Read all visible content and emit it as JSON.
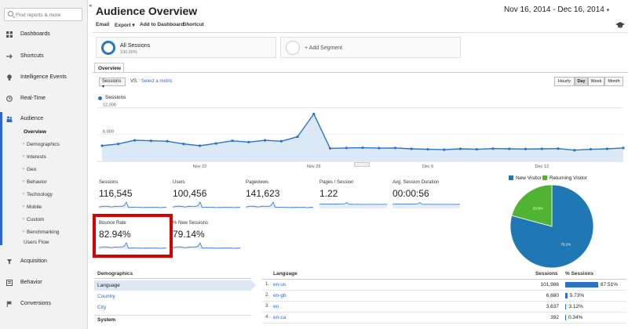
{
  "sidebar": {
    "search_placeholder": "Find reports & more",
    "items": [
      {
        "label": "Dashboards"
      },
      {
        "label": "Shortcuts"
      },
      {
        "label": "Intelligence Events"
      },
      {
        "label": "Real-Time"
      },
      {
        "label": "Audience"
      },
      {
        "label": "Acquisition"
      },
      {
        "label": "Behavior"
      },
      {
        "label": "Conversions"
      }
    ],
    "audience_sub": [
      {
        "label": "Overview"
      },
      {
        "label": "Demographics"
      },
      {
        "label": "Interests"
      },
      {
        "label": "Geo"
      },
      {
        "label": "Behavior"
      },
      {
        "label": "Technology"
      },
      {
        "label": "Mobile"
      },
      {
        "label": "Custom"
      },
      {
        "label": "Benchmarking"
      },
      {
        "label": "Users Flow"
      }
    ]
  },
  "header": {
    "title": "Audience Overview",
    "date_range": "Nov 16, 2014 - Dec 16, 2014"
  },
  "toolbar": {
    "email": "Email",
    "export": "Export",
    "add_dashboard": "Add to Dashboard",
    "shortcut": "Shortcut"
  },
  "segments": {
    "all_sessions": "All Sessions",
    "all_sessions_pct": "100.00%",
    "add_segment": "+ Add Segment"
  },
  "tabs": {
    "overview": "Overview"
  },
  "chart_controls": {
    "metric": "Sessions",
    "vs": "VS.",
    "select_metric": "Select a metric",
    "granularity": [
      "Hourly",
      "Day",
      "Week",
      "Month"
    ],
    "selected_granularity": "Day"
  },
  "chart_data": {
    "type": "area",
    "legend": "Sessions",
    "y_ticks": [
      6000,
      12000
    ],
    "y_tick_labels": [
      "6,000",
      "12,000"
    ],
    "ylim": [
      0,
      12600
    ],
    "x_tick_labels": [
      "Nov 22",
      "Nov 29",
      "Dec 6",
      "Dec 13"
    ],
    "x_tick_indices": [
      6,
      13,
      20,
      27
    ],
    "values": [
      3500,
      3900,
      4700,
      4600,
      4500,
      3900,
      3500,
      4000,
      4600,
      4300,
      4700,
      4500,
      5500,
      10600,
      2900,
      3000,
      3050,
      2950,
      3000,
      2800,
      2700,
      2600,
      2800,
      2700,
      2850,
      2800,
      2750,
      2800,
      2850,
      2500,
      2700,
      2800,
      3000
    ],
    "color": "#2a73c5",
    "fill": "#dbe9f6"
  },
  "metrics": [
    {
      "label": "Sessions",
      "value": "116,545"
    },
    {
      "label": "Users",
      "value": "100,456"
    },
    {
      "label": "Pageviews",
      "value": "141,623"
    },
    {
      "label": "Pages / Session",
      "value": "1.22"
    },
    {
      "label": "Avg. Session Duration",
      "value": "00:00:56"
    },
    {
      "label": "Bounce Rate",
      "value": "82.94%"
    },
    {
      "label": "% New Sessions",
      "value": "79.14%"
    }
  ],
  "pie": {
    "legend": [
      {
        "label": "New Visitor",
        "color": "#1f77b4"
      },
      {
        "label": "Returning Visitor",
        "color": "#50b432"
      }
    ],
    "slices": [
      {
        "label": "79.2%",
        "value": 79.2,
        "color": "#1f77b4"
      },
      {
        "label": "20.8%",
        "value": 20.8,
        "color": "#50b432"
      }
    ]
  },
  "demographics": {
    "heading": "Demographics",
    "links": [
      "Language",
      "Country",
      "City"
    ],
    "selected": "Language",
    "system": "System"
  },
  "language_table": {
    "headers": {
      "language": "Language",
      "sessions": "Sessions",
      "pct": "% Sessions"
    },
    "rows": [
      {
        "num": "1.",
        "lang": "en-us",
        "sessions": "101,986",
        "pct": "87.51%",
        "pct_value": 87.51
      },
      {
        "num": "2.",
        "lang": "en-gb",
        "sessions": "6,680",
        "pct": "5.73%",
        "pct_value": 5.73
      },
      {
        "num": "3.",
        "lang": "en",
        "sessions": "3,637",
        "pct": "3.12%",
        "pct_value": 3.12
      },
      {
        "num": "4.",
        "lang": "en-ca",
        "sessions": "392",
        "pct": "0.34%",
        "pct_value": 0.34
      }
    ]
  }
}
